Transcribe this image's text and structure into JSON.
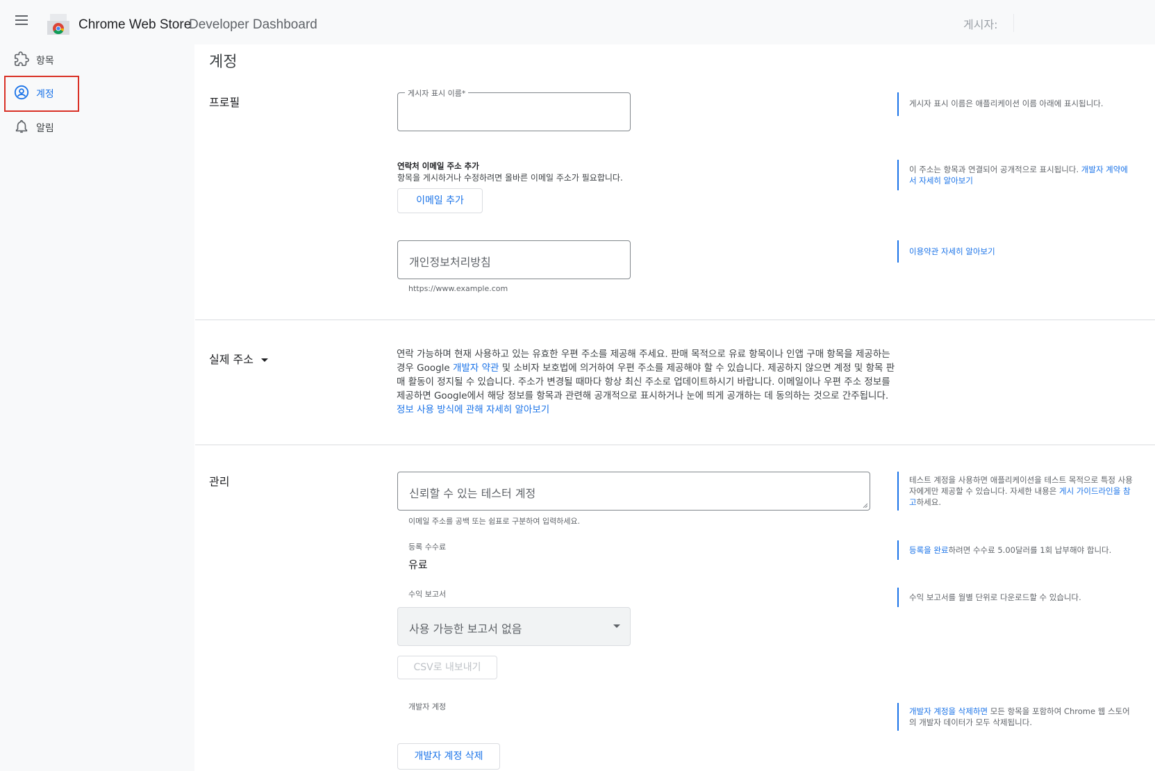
{
  "header": {
    "app_title": "Chrome Web Store",
    "app_subtitle": "Developer Dashboard",
    "publisher_label": "게시자:"
  },
  "sidebar": {
    "items": [
      {
        "label": "항목",
        "icon": "puzzle-icon",
        "active": false
      },
      {
        "label": "계정",
        "icon": "account-circle-icon",
        "active": true
      },
      {
        "label": "알림",
        "icon": "bell-icon",
        "active": false
      }
    ]
  },
  "page": {
    "title": "계정"
  },
  "profile": {
    "section_title": "프로필",
    "display_name_label": "게시자 표시 이름*",
    "display_name_value": "",
    "display_name_help": "게시자 표시 이름은 애플리케이션 이름 아래에 표시됩니다.",
    "email_title": "연락처 이메일 주소 추가",
    "email_desc": "항목을 게시하거나 수정하려면 올바른 이메일 주소가 필요합니다.",
    "add_email_button": "이메일 추가",
    "email_help_text": "이 주소는 항목과 연결되어 공개적으로 표시됩니다.",
    "email_help_link": "개발자 계약에서 자세히 알아보기",
    "privacy_placeholder": "개인정보처리방침",
    "privacy_hint": "https://www.example.com",
    "privacy_help_link": "이용약관 자세히 알아보기"
  },
  "address": {
    "section_title": "실제 주소",
    "text_1": "연락 가능하며 현재 사용하고 있는 유효한 우편 주소를 제공해 주세요. 판매 목적으로 유료 항목이나 인앱 구매 항목을 제공하는 경우 Google ",
    "link_1": "개발자 약관",
    "text_2": " 및 소비자 보호법에 의거하여 우편 주소를 제공해야 할 수 있습니다. 제공하지 않으면 계정 및 항목 판매 활동이 정지될 수 있습니다. 주소가 변경될 때마다 항상 최신 주소로 업데이트하시기 바랍니다. 이메일이나 우편 주소 정보를 제공하면 Google에서 해당 정보를 항목과 관련해 공개적으로 표시하거나 눈에 띄게 공개하는 데 동의하는 것으로 간주됩니다. ",
    "link_2": "정보 사용 방식에 관해 자세히 알아보기"
  },
  "management": {
    "section_title": "관리",
    "testers_placeholder": "신뢰할 수 있는 테스터 계정",
    "testers_hint": "이메일 주소를 공백 또는 쉼표로 구분하여 입력하세요.",
    "testers_help_text": "테스트 계정을 사용하면 애플리케이션을 테스트 목적으로 특정 사용자에게만 제공할 수 있습니다. 자세한 내용은 ",
    "testers_help_link": "게시 가이드라인을 참고",
    "testers_help_tail": "하세요.",
    "fee_label": "등록 수수료",
    "fee_value": "유료",
    "fee_help_link": "등록을 완료",
    "fee_help_text": "하려면 수수료 5.00달러를 1회 납부해야 합니다.",
    "report_label": "수익 보고서",
    "report_select_value": "사용 가능한 보고서 없음",
    "report_help": "수익 보고서를 월별 단위로 다운로드할 수 있습니다.",
    "csv_button": "CSV로 내보내기",
    "dev_account_label": "개발자 계정",
    "dev_help_link": "개발자 계정을 삭제하면",
    "dev_help_text": " 모든 항목을 포함하여 Chrome 웹 스토어의 개발자 데이터가 모두 삭제됩니다.",
    "delete_button": "개발자 계정 삭제"
  },
  "colors": {
    "accent": "#1a73e8",
    "highlight": "#d93025",
    "sidebar_bg": "#f8f9fa"
  }
}
